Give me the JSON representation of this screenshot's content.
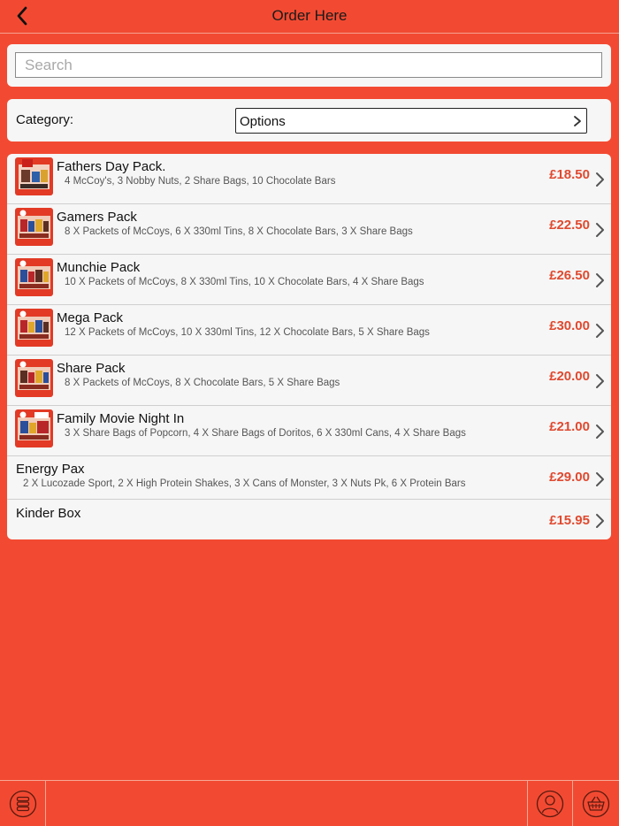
{
  "header": {
    "title": "Order Here",
    "back_icon": "chevron-left-icon"
  },
  "search": {
    "placeholder": "Search",
    "value": ""
  },
  "category": {
    "label": "Category:",
    "selected": "Options"
  },
  "colors": {
    "background": "#f24a32",
    "price": "#e0492f",
    "card": "#f6f6f6"
  },
  "items": [
    {
      "title": "Fathers Day Pack.",
      "desc": "4 McCoy's, 3 Nobby Nuts, 2 Share Bags, 10 Chocolate Bars",
      "price": "£18.50",
      "thumb": "product-thumbnail"
    },
    {
      "title": "Gamers Pack",
      "desc": "8 X Packets of McCoys, 6 X 330ml Tins, 8 X Chocolate Bars, 3 X Share Bags",
      "price": "£22.50",
      "thumb": "product-thumbnail"
    },
    {
      "title": "Munchie Pack",
      "desc": "10 X Packets of McCoys, 8 X 330ml Tins, 10 X Chocolate Bars, 4 X Share Bags",
      "price": "£26.50",
      "thumb": "product-thumbnail"
    },
    {
      "title": "Mega Pack",
      "desc": "12 X Packets of McCoys, 10 X 330ml Tins, 12 X Chocolate Bars, 5 X Share Bags",
      "price": "£30.00",
      "thumb": "product-thumbnail"
    },
    {
      "title": "Share Pack",
      "desc": "8 X Packets of McCoys, 8 X Chocolate Bars, 5 X Share Bags",
      "price": "£20.00",
      "thumb": "product-thumbnail"
    },
    {
      "title": "Family Movie Night In",
      "desc": "3 X Share Bags of Popcorn, 4 X Share Bags of Doritos, 6 X 330ml Cans, 4 X Share Bags",
      "price": "£21.00",
      "thumb": "product-thumbnail"
    },
    {
      "title": "Energy Pax",
      "desc": "2 X Lucozade Sport, 2 X High Protein Shakes, 3 X Cans of Monster, 3 X Nuts Pk, 6 X Protein Bars",
      "price": "£29.00"
    },
    {
      "title": "Kinder Box",
      "desc": "",
      "price": "£15.95"
    }
  ],
  "tabbar": {
    "left_icon": "menu-stack-icon",
    "account_icon": "user-icon",
    "basket_icon": "basket-icon"
  }
}
